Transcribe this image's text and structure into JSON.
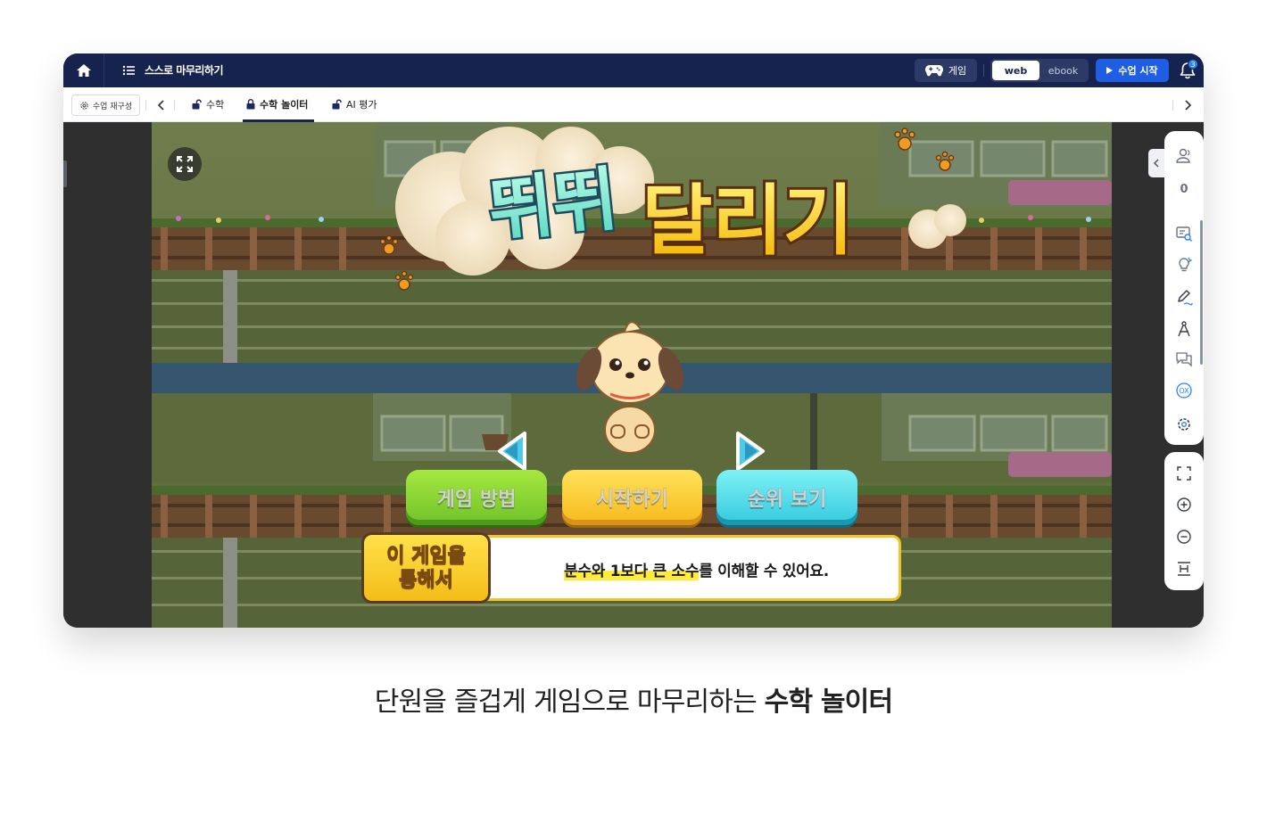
{
  "header": {
    "title": "스스로 마무리하기",
    "game_label": "게임",
    "view_toggle": {
      "web": "web",
      "ebook": "ebook",
      "selected": "web"
    },
    "start_label": "수업 시작",
    "notification_count": "3"
  },
  "tabbar": {
    "reconfigure_label": "수업 재구성",
    "tabs": [
      {
        "label": "수학",
        "icon": "unlock-icon",
        "active": false
      },
      {
        "label": "수학 놀이터",
        "icon": "lock-icon",
        "active": true
      },
      {
        "label": "AI 평가",
        "icon": "unlock-icon",
        "active": false
      }
    ]
  },
  "game": {
    "title_part1": "뛰뛰",
    "title_part2": "달리기",
    "buttons": {
      "how_to": "게임 방법",
      "start": "시작하기",
      "ranking": "순위 보기"
    },
    "goal_label_line1": "이 게임을",
    "goal_label_line2": "통해서",
    "goal_highlight": "분수와 1보다 큰 소수",
    "goal_rest": "를 이해할 수 있어요."
  },
  "right_rail": {
    "participant_count": "0",
    "tools": [
      "people-icon",
      "screen-search-icon",
      "lightbulb-icon",
      "pen-icon",
      "compass-icon",
      "chat-icon",
      "ox-quiz-icon",
      "settings-icon"
    ],
    "view_tools": [
      "fullscreen-icon",
      "zoom-in-icon",
      "zoom-out-icon",
      "fit-width-icon"
    ]
  },
  "caption": {
    "normal": "단원을 즐겁게 게임으로 마무리하는 ",
    "bold": "수학 놀이터"
  },
  "colors": {
    "topbar": "#17234f",
    "primary": "#1f5de3",
    "accent_yellow": "#f2c526"
  }
}
